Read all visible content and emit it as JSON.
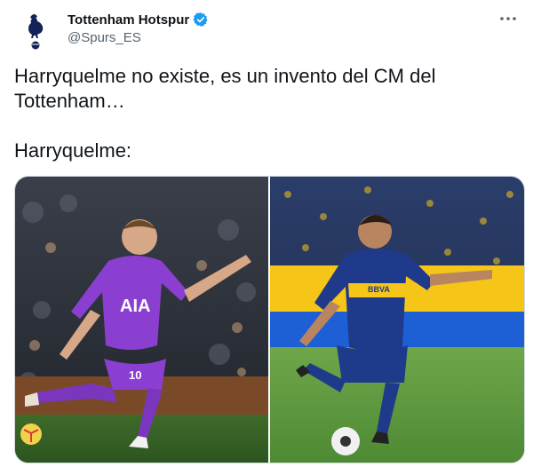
{
  "tweet": {
    "author_name": "Tottenham Hotspur",
    "handle": "@Spurs_ES",
    "text_line1": "Harryquelme no existe, es un invento del CM del Tottenham…",
    "text_line2": "Harryquelme:",
    "icons": {
      "avatar": "cockerel-logo-icon",
      "verified": "verified-badge-icon",
      "more": "more-options-icon"
    },
    "colors": {
      "verified": "#1d9bf0",
      "spurs_purple": "#8b3fd0",
      "boca_blue": "#1f3a8a",
      "boca_gold": "#f5c518"
    },
    "media": {
      "left_image": {
        "shirt_sponsor": "AIA",
        "shirt_number": "10"
      },
      "right_image": {
        "shirt_sponsor": "BBVA"
      }
    }
  }
}
